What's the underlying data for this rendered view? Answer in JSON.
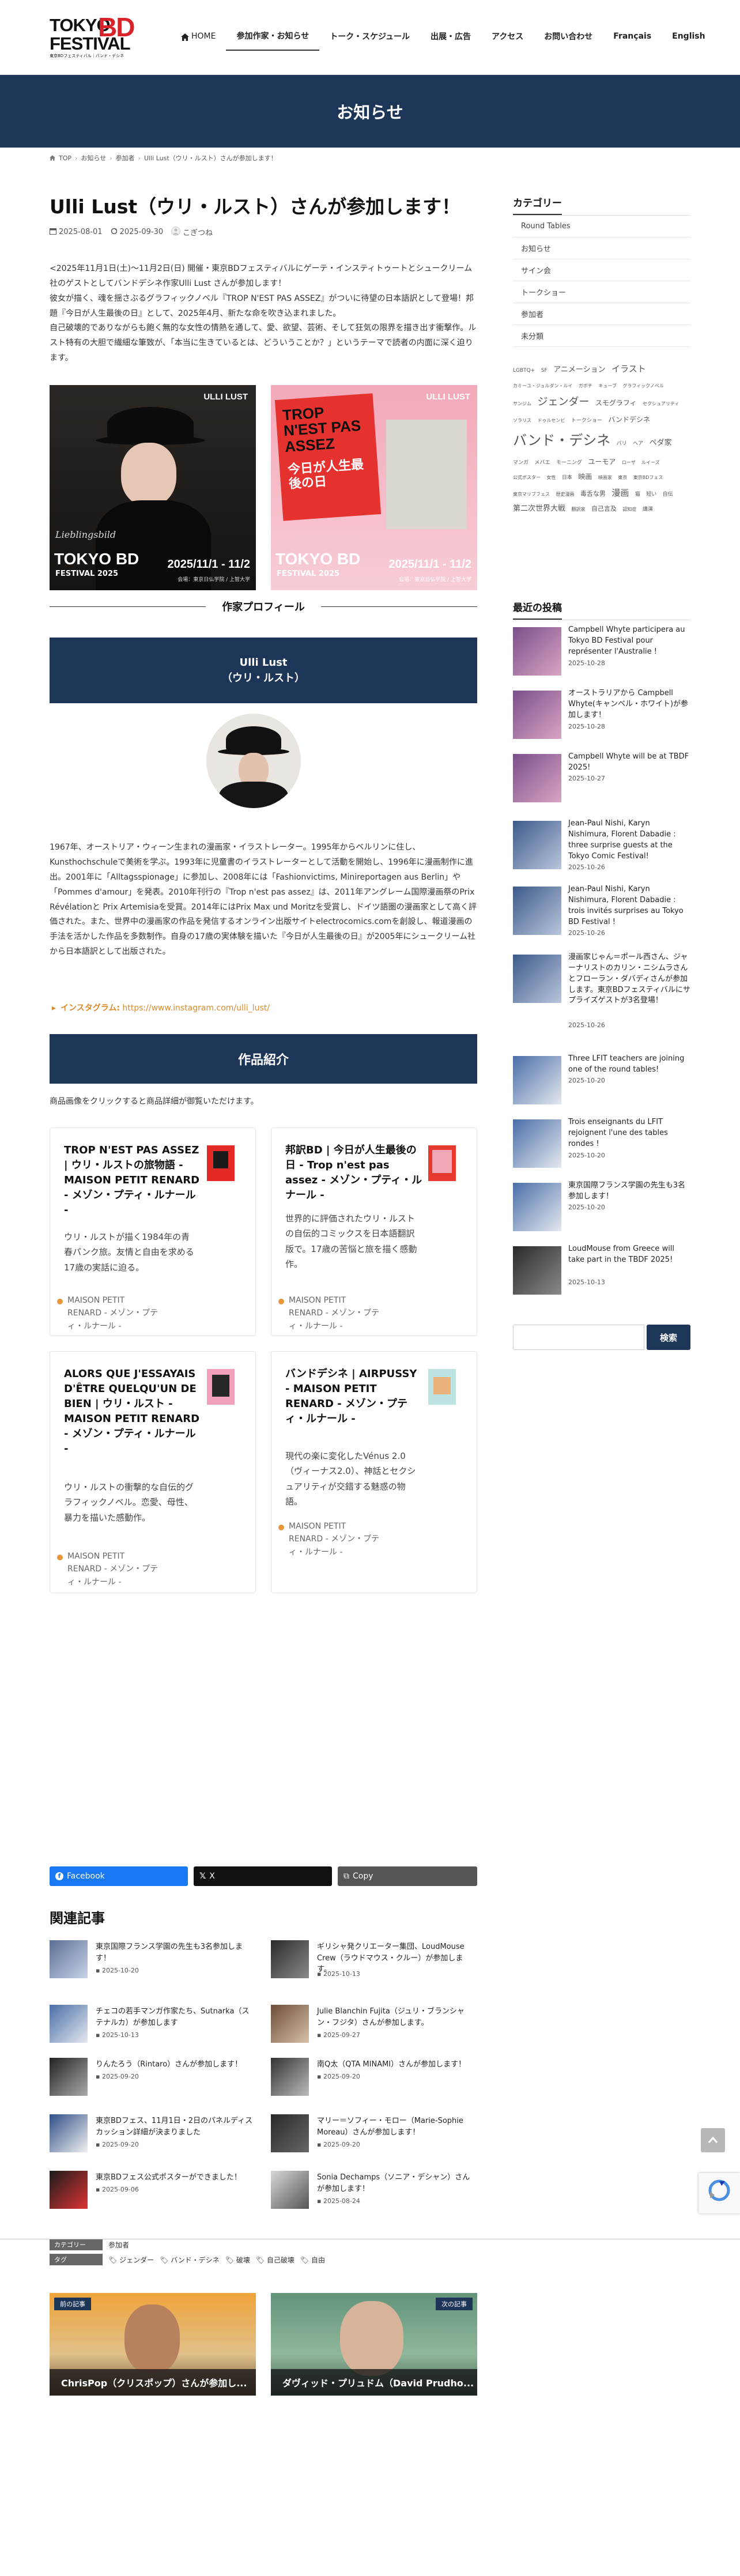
{
  "header": {
    "logo_line1": "TOKYO",
    "logo_bd": "BD",
    "logo_line2": "FESTIVAL",
    "logo_sub": "東京BDフェスティバル｜バンド・デシネ",
    "nav": [
      {
        "label": "HOME"
      },
      {
        "label": "参加作家・お知らせ"
      },
      {
        "label": "トーク・スケジュール"
      },
      {
        "label": "出展・広告"
      },
      {
        "label": "アクセス"
      },
      {
        "label": "お問い合わせ"
      },
      {
        "label": "Français"
      },
      {
        "label": "English"
      }
    ]
  },
  "hero": {
    "title": "お知らせ"
  },
  "breadcrumb": [
    "TOP",
    "お知らせ",
    "参加者",
    "Ulli Lust（ウリ・ルスト）さんが参加します！"
  ],
  "post": {
    "title": "Ulli Lust（ウリ・ルスト）さんが参加します！",
    "date": "2025-08-01",
    "updated": "2025-09-30",
    "author": "こぎつね",
    "intro_1": "<2025年11月1日(土)〜11月2日(日) 開催・東京BDフェスティバルにゲーテ・インスティトゥートとシュークリーム社のゲストとしてバンドデシネ作家Ulli Lust さんが参加します！",
    "intro_2": "彼女が描く、魂を揺さぶるグラフィックノベル『TROP N'EST PAS ASSEZ』がついに待望の日本語訳として登場！邦題『今日が人生最後の日』として、2025年4月、新たな命を吹き込まれました。",
    "intro_3": "自己破壊的でありながらも飽く無的な女性の情熱を通して、愛、欲望、芸術、そして狂気の限界を描き出す衝撃作。ルスト特有の大胆で繊細な筆致が、「本当に生きているとは、どういうことか？」というテーマで読者の内面に深く迫ります。",
    "poster1": {
      "name": "ULLI LUST",
      "script": "Lieblingsbild",
      "fest": "TOKYO BD",
      "year": "FESTIVAL 2025",
      "dates": "2025/11/1 - 11/2",
      "venue": "会場：東京日仏学院 / 上智大学"
    },
    "poster2": {
      "title": "TROP N'EST PAS ASSEZ",
      "jp": "今日が人生最後の日",
      "name": "ULLI LUST",
      "fest": "TOKYO BD",
      "year": "FESTIVAL 2025",
      "dates": "2025/11/1 - 11/2",
      "venue": "会場：東京日仏学院 / 上智大学"
    },
    "profile_heading": "作家プロフィール",
    "name_en": "Ulli Lust",
    "name_jp": "（ウリ・ルスト）",
    "bio": "1967年、オーストリア・ウィーン生まれの漫画家・イラストレーター。1995年からベルリンに住し、Kunsthochschuleで美術を学ぶ。1993年に児童書のイラストレーターとして活動を開始し、1996年に漫画制作に進出。2001年に「Alltagsspionage」に参加し、2008年には「Fashionvictims, Minireportagen aus Berlin」や「Pommes d'amour」を発表。2010年刊行の『Trop n'est pas assez』は、2011年アングレーム国際漫画祭のPrix Révélationと Prix Artemisiaを受賞。2014年にはPrix Max und Moritzを受賞し、ドイツ語圏の漫画家として高く評価された。また、世界中の漫画家の作品を発信するオンライン出版サイトelectrocomics.comを創設し、報道漫画の手法を活かした作品を多数制作。自身の17歳の実体験を描いた『今日が人生最後の日』が2005年にシュークリーム社から日本語訳として出版された。",
    "insta_label": "インスタグラム:",
    "insta_url": "https://www.instagram.com/ulli_lust/",
    "works_heading": "作品紹介",
    "works_note": "商品画像をクリックすると商品詳細が御覧いただけます。",
    "works": [
      {
        "title": "TROP N'EST PAS ASSEZ | ウリ・ルストの旅物語 - MAISON PETIT RENARD - メゾン・プティ・ルナール -",
        "desc": "ウリ・ルストが描く1984年の青春パンク旅。友情と自由を求める17歳の実話に迫る。",
        "source": "MAISON PETIT RENARD - メゾン・プティ・ルナール -"
      },
      {
        "title": "邦訳BD | 今日が人生最後の日 - Trop n'est pas assez - メゾン・プティ・ルナール -",
        "desc": "世界的に評価されたウリ・ルストの自伝的コミックスを日本語翻訳版で。17歳の苦悩と旅を描く感動作。",
        "source": "MAISON PETIT RENARD - メゾン・プティ・ルナール -"
      },
      {
        "title": "ALORS QUE J'ESSAYAIS D'ÊTRE QUELQU'UN DE BIEN | ウリ・ルスト - MAISON PETIT RENARD - メゾン・プティ・ルナール -",
        "desc": "ウリ・ルストの衝撃的な自伝的グラフィックノベル。恋愛、母性、暴力を描いた感動作。",
        "source": "MAISON PETIT RENARD - メゾン・プティ・ルナール -"
      },
      {
        "title": "バンドデシネ | AIRPUSSY - MAISON PETIT RENARD - メゾン・プティ・ルナール -",
        "desc": "現代の楽に変化したVénus 2.0（ヴィーナス2.0）、神話とセクシュアリティが交錯する魅惑の物語。",
        "source": "MAISON PETIT RENARD - メゾン・プティ・ルナール -"
      }
    ],
    "share": {
      "facebook": "Facebook",
      "x": "X",
      "copy": "Copy"
    },
    "related_heading": "関連記事",
    "related": [
      {
        "title": "東京国際フランス学園の先生も3名参加します！",
        "date": "2025-10-20"
      },
      {
        "title": "ギリシャ発クリエーター集団、LoudMouse Crew（ラウドマウス・クルー）が参加します。",
        "date": "2025-10-13"
      },
      {
        "title": "チェコの若手マンガ作家たち、Sutnarka（ステナルカ）が参加します",
        "date": "2025-10-13"
      },
      {
        "title": "Julie Blanchin Fujita（ジュリ・ブランシャン・フジタ）さんが参加します。",
        "date": "2025-09-27"
      },
      {
        "title": "りんたろう（Rintaro）さんが参加します！",
        "date": "2025-09-20"
      },
      {
        "title": "南Q太（QTA MINAMI）さんが参加します！",
        "date": "2025-09-20"
      },
      {
        "title": "東京BDフェス、11月1日・2日のパネルディスカッション詳細が決まりました",
        "date": "2025-09-20"
      },
      {
        "title": "マリー＝ソフィー・モロー（Marie-Sophie Moreau）さんが参加します！",
        "date": "2025-09-20"
      },
      {
        "title": "東京BDフェス公式ポスターができました！",
        "date": "2025-09-06"
      },
      {
        "title": "Sonia Dechamps（ソニア・デシャン）さんが参加します！",
        "date": "2025-08-24"
      }
    ],
    "tags_label_cat": "カテゴリー",
    "tags_cat": "参加者",
    "tags_label_tag": "タグ",
    "tags": [
      "ジェンダー",
      "バンド・デシネ",
      "破壊",
      "自己破壊",
      "自由"
    ],
    "prev_label": "前の記事",
    "prev_title": "ChrisPop（クリスポップ）さんが参加し...",
    "next_label": "次の記事",
    "next_title": "ダヴィッド・プリュドム（David Prudho..."
  },
  "sidebar": {
    "categories_heading": "カテゴリー",
    "categories": [
      "Round Tables",
      "お知らせ",
      "サイン会",
      "トークショー",
      "参加者",
      "未分類"
    ],
    "tags": [
      {
        "t": "LGBTQ+",
        "s": 9
      },
      {
        "t": "SF",
        "s": 9
      },
      {
        "t": "アニメーション",
        "s": 13
      },
      {
        "t": "イラスト",
        "s": 15
      },
      {
        "t": "カミーユ・ジュルダン・ルイ",
        "s": 8
      },
      {
        "t": "ガボチ",
        "s": 8
      },
      {
        "t": "キューブ",
        "s": 8
      },
      {
        "t": "グラフィックノベル",
        "s": 8
      },
      {
        "t": "サンジム",
        "s": 8
      },
      {
        "t": "ジェンダー",
        "s": 18
      },
      {
        "t": "スモグラフィ",
        "s": 12
      },
      {
        "t": "セクシュアリティ",
        "s": 8
      },
      {
        "t": "ソラリス",
        "s": 8
      },
      {
        "t": "ドゥルセンビ",
        "s": 8
      },
      {
        "t": "トークショー",
        "s": 9
      },
      {
        "t": "バンドデシネ",
        "s": 12
      },
      {
        "t": "バンド・デシネ",
        "s": 24
      },
      {
        "t": "パリ",
        "s": 9
      },
      {
        "t": "ヘア",
        "s": 9
      },
      {
        "t": "ペダ家",
        "s": 13
      },
      {
        "t": "マンガ",
        "s": 9
      },
      {
        "t": "メバエ",
        "s": 9
      },
      {
        "t": "モーニング",
        "s": 9
      },
      {
        "t": "ユーモア",
        "s": 12
      },
      {
        "t": "ローザ",
        "s": 8
      },
      {
        "t": "ルイーズ",
        "s": 8
      },
      {
        "t": "公式ポスター",
        "s": 8
      },
      {
        "t": "女性",
        "s": 8
      },
      {
        "t": "日本",
        "s": 9
      },
      {
        "t": "映画",
        "s": 12
      },
      {
        "t": "映画家",
        "s": 8
      },
      {
        "t": "東京",
        "s": 8
      },
      {
        "t": "東京BDフェス",
        "s": 8
      },
      {
        "t": "東京マリブフェス",
        "s": 8
      },
      {
        "t": "歴史漫画",
        "s": 8
      },
      {
        "t": "毒舌な男",
        "s": 11
      },
      {
        "t": "漫画",
        "s": 15
      },
      {
        "t": "猫",
        "s": 9
      },
      {
        "t": "短い",
        "s": 9
      },
      {
        "t": "自伝",
        "s": 9
      },
      {
        "t": "第二次世界大戦",
        "s": 13
      },
      {
        "t": "翻訳家",
        "s": 8
      },
      {
        "t": "自己言及",
        "s": 11
      },
      {
        "t": "認知症",
        "s": 8
      },
      {
        "t": "講演",
        "s": 9
      }
    ],
    "recent_heading": "最近の投稿",
    "recent": [
      {
        "title": "Campbell Whyte participera au Tokyo BD Festival pour représenter l'Australie !",
        "date": "2025-10-28"
      },
      {
        "title": "オーストラリアから Campbell Whyte(キャンベル・ホワイト)が参加します！",
        "date": "2025-10-28"
      },
      {
        "title": "Campbell Whyte will be at TBDF 2025!",
        "date": "2025-10-27"
      },
      {
        "title": "Jean-Paul Nishi, Karyn Nishimura, Florent Dabadie : three surprise guests at the Tokyo Comic Festival!",
        "date": "2025-10-26"
      },
      {
        "title": "Jean-Paul Nishi, Karyn Nishimura, Florent Dabadie : trois invités surprises au Tokyo BD Festival !",
        "date": "2025-10-26"
      },
      {
        "title": "漫画家じゃん＝ポール西さん、ジャーナリストのカリン・ニシムラさんとフローラン・ダバディさんが参加します。東京BDフェスティバルにサプライズゲストが3名登場！",
        "date": "2025-10-26"
      },
      {
        "title": "Three LFIT teachers are joining one of the round tables!",
        "date": "2025-10-20"
      },
      {
        "title": "Trois enseignants du LFIT rejoignent l'une des tables rondes !",
        "date": "2025-10-20"
      },
      {
        "title": "東京国際フランス学園の先生も3名参加します！",
        "date": "2025-10-20"
      },
      {
        "title": "LoudMouse from Greece will take part in the TBDF 2025!",
        "date": "2025-10-13"
      }
    ],
    "search_button": "検索"
  }
}
